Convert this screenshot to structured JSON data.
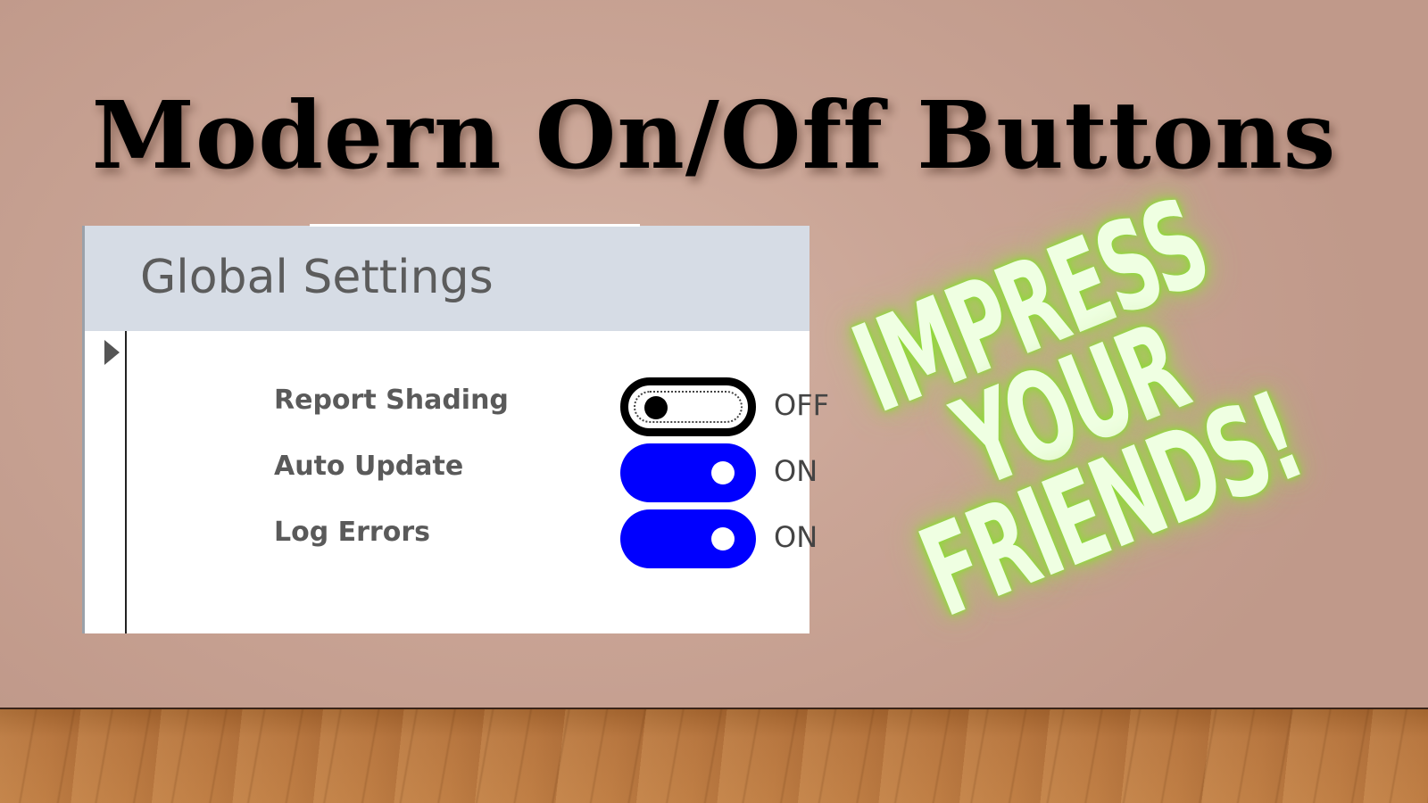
{
  "headline": "Modern On/Off Buttons",
  "panel": {
    "title": "Global Settings",
    "settings": [
      {
        "label": "Report Shading",
        "state": "OFF",
        "on": false
      },
      {
        "label": "Auto Update",
        "state": "ON",
        "on": true
      },
      {
        "label": "Log Errors",
        "state": "ON",
        "on": true
      }
    ]
  },
  "promo": {
    "lines": [
      "IMPRESS",
      "YOUR",
      "FRIENDS!"
    ]
  },
  "colors": {
    "toggle_on": "#0000ff",
    "toggle_off_border": "#000000",
    "header_bg": "#d6dce5",
    "promo_text": "#efffe2",
    "promo_glow": "#8fe03a"
  }
}
